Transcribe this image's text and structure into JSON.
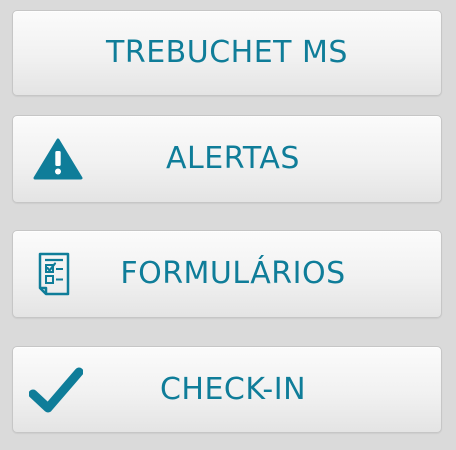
{
  "menu": {
    "buttons": [
      {
        "label": "TREBUCHET MS",
        "icon": null
      },
      {
        "label": "ALERTAS",
        "icon": "warning-icon"
      },
      {
        "label": "FORMULÁRIOS",
        "icon": "form-checklist-icon"
      },
      {
        "label": "CHECK-IN",
        "icon": "checkmark-icon"
      }
    ]
  },
  "colors": {
    "accent": "#0f7d99",
    "button_background": "#f1f1f1",
    "page_background": "#dadada"
  }
}
